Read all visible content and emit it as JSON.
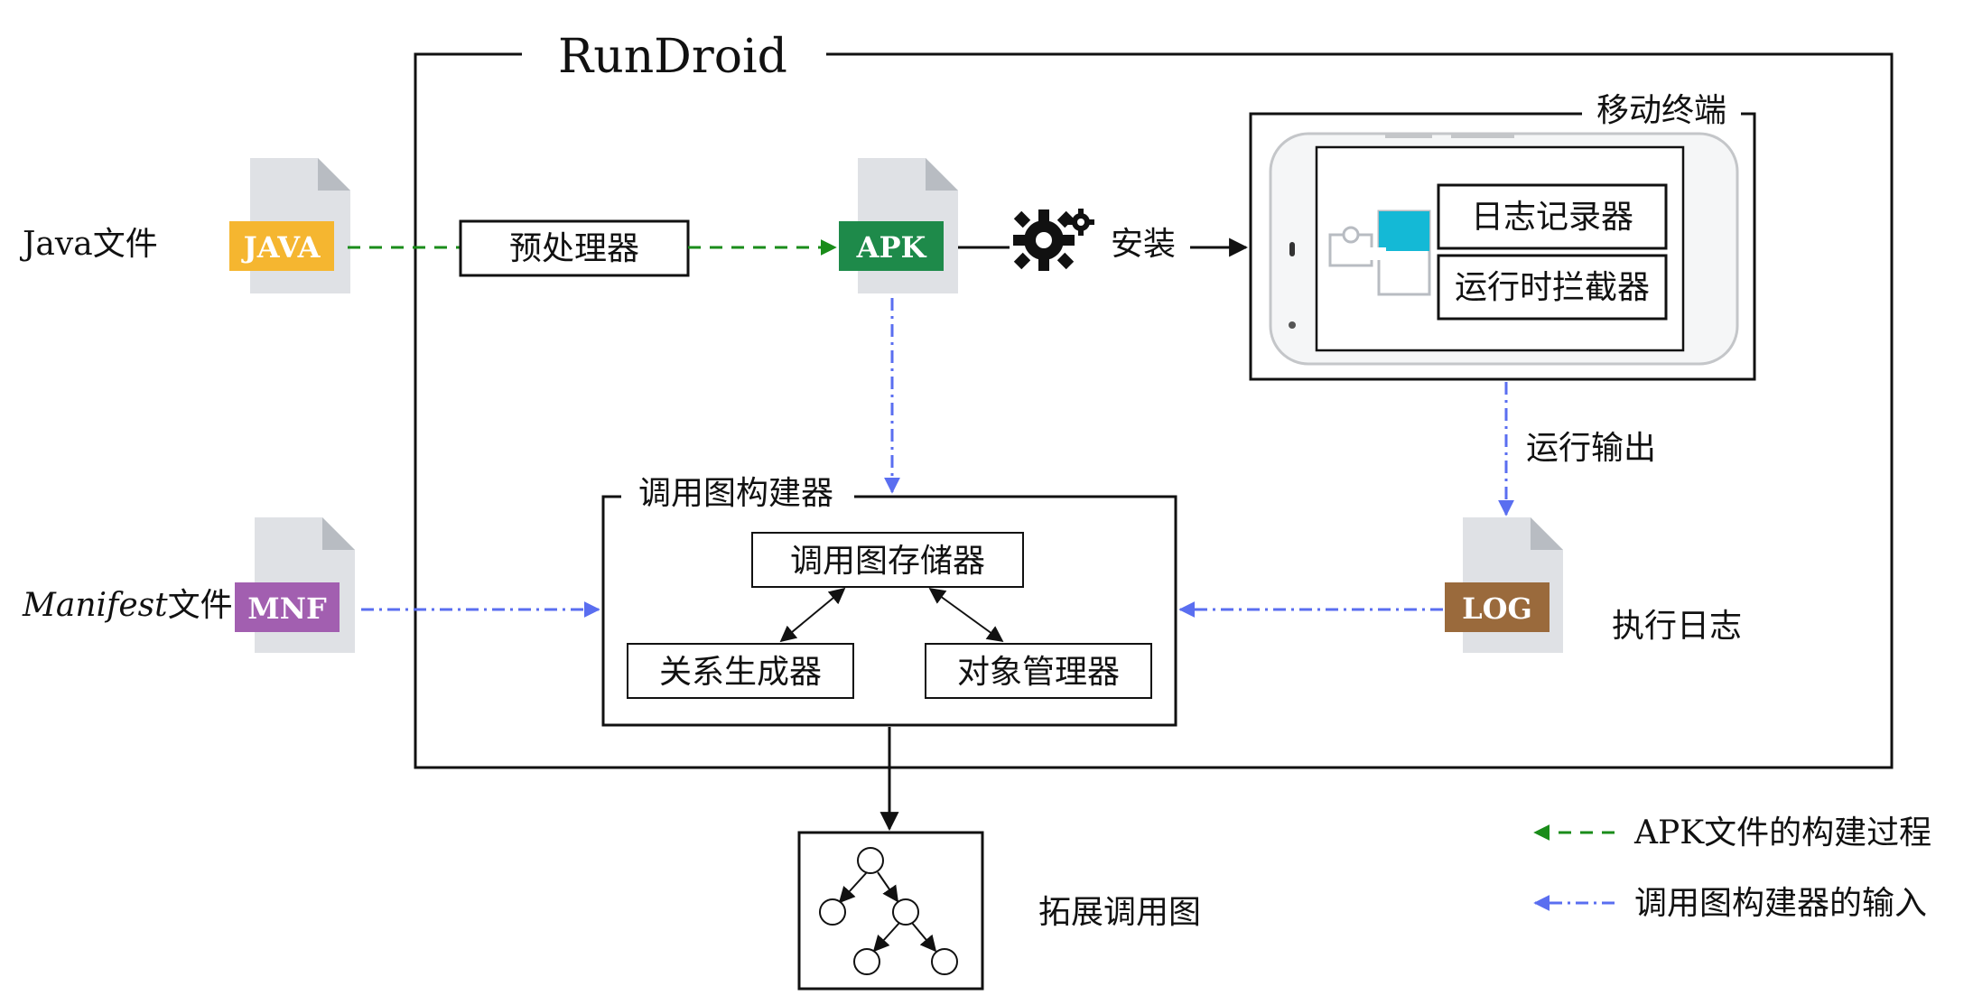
{
  "system_title": "RunDroid",
  "inputs": {
    "java_label": "Java文件",
    "java_badge": "JAVA",
    "manifest_label_italic": "Manifest",
    "manifest_label_suffix": "文件",
    "manifest_badge": "MNF"
  },
  "preprocessor": "预处理器",
  "apk_badge": "APK",
  "install_label": "安装",
  "mobile": {
    "title": "移动终端",
    "logger": "日志记录器",
    "interceptor": "运行时拦截器"
  },
  "run_output_label": "运行输出",
  "log_badge": "LOG",
  "log_label": "执行日志",
  "builder": {
    "title": "调用图构建器",
    "storage": "调用图存储器",
    "relation": "关系生成器",
    "object_manager": "对象管理器"
  },
  "output_label": "拓展调用图",
  "legend": [
    {
      "label": "APK文件的构建过程",
      "style": "dashed",
      "color": "#1a8c1a"
    },
    {
      "label": "调用图构建器的输入",
      "style": "dashdot",
      "color": "#5a6ef0"
    }
  ],
  "colors": {
    "java_badge": "#f5b630",
    "apk_badge": "#1e8a4a",
    "mnf_badge": "#a25fb0",
    "log_badge": "#9a6a3c",
    "file_page": "#dfe1e5",
    "file_fold": "#b8bcc2",
    "phone_accent": "#14b9d6"
  }
}
